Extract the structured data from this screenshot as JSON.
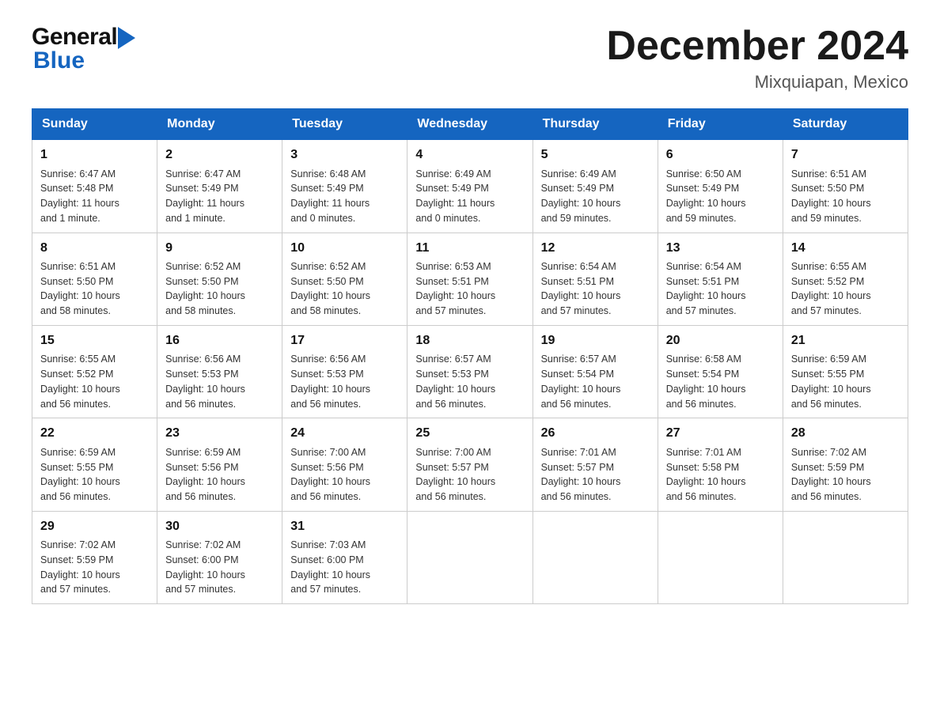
{
  "header": {
    "logo_general": "General",
    "logo_blue": "Blue",
    "month_title": "December 2024",
    "location": "Mixquiapan, Mexico"
  },
  "days_of_week": [
    "Sunday",
    "Monday",
    "Tuesday",
    "Wednesday",
    "Thursday",
    "Friday",
    "Saturday"
  ],
  "weeks": [
    [
      {
        "day": "1",
        "sunrise": "6:47 AM",
        "sunset": "5:48 PM",
        "daylight": "11 hours and 1 minute."
      },
      {
        "day": "2",
        "sunrise": "6:47 AM",
        "sunset": "5:49 PM",
        "daylight": "11 hours and 1 minute."
      },
      {
        "day": "3",
        "sunrise": "6:48 AM",
        "sunset": "5:49 PM",
        "daylight": "11 hours and 0 minutes."
      },
      {
        "day": "4",
        "sunrise": "6:49 AM",
        "sunset": "5:49 PM",
        "daylight": "11 hours and 0 minutes."
      },
      {
        "day": "5",
        "sunrise": "6:49 AM",
        "sunset": "5:49 PM",
        "daylight": "10 hours and 59 minutes."
      },
      {
        "day": "6",
        "sunrise": "6:50 AM",
        "sunset": "5:49 PM",
        "daylight": "10 hours and 59 minutes."
      },
      {
        "day": "7",
        "sunrise": "6:51 AM",
        "sunset": "5:50 PM",
        "daylight": "10 hours and 59 minutes."
      }
    ],
    [
      {
        "day": "8",
        "sunrise": "6:51 AM",
        "sunset": "5:50 PM",
        "daylight": "10 hours and 58 minutes."
      },
      {
        "day": "9",
        "sunrise": "6:52 AM",
        "sunset": "5:50 PM",
        "daylight": "10 hours and 58 minutes."
      },
      {
        "day": "10",
        "sunrise": "6:52 AM",
        "sunset": "5:50 PM",
        "daylight": "10 hours and 58 minutes."
      },
      {
        "day": "11",
        "sunrise": "6:53 AM",
        "sunset": "5:51 PM",
        "daylight": "10 hours and 57 minutes."
      },
      {
        "day": "12",
        "sunrise": "6:54 AM",
        "sunset": "5:51 PM",
        "daylight": "10 hours and 57 minutes."
      },
      {
        "day": "13",
        "sunrise": "6:54 AM",
        "sunset": "5:51 PM",
        "daylight": "10 hours and 57 minutes."
      },
      {
        "day": "14",
        "sunrise": "6:55 AM",
        "sunset": "5:52 PM",
        "daylight": "10 hours and 57 minutes."
      }
    ],
    [
      {
        "day": "15",
        "sunrise": "6:55 AM",
        "sunset": "5:52 PM",
        "daylight": "10 hours and 56 minutes."
      },
      {
        "day": "16",
        "sunrise": "6:56 AM",
        "sunset": "5:53 PM",
        "daylight": "10 hours and 56 minutes."
      },
      {
        "day": "17",
        "sunrise": "6:56 AM",
        "sunset": "5:53 PM",
        "daylight": "10 hours and 56 minutes."
      },
      {
        "day": "18",
        "sunrise": "6:57 AM",
        "sunset": "5:53 PM",
        "daylight": "10 hours and 56 minutes."
      },
      {
        "day": "19",
        "sunrise": "6:57 AM",
        "sunset": "5:54 PM",
        "daylight": "10 hours and 56 minutes."
      },
      {
        "day": "20",
        "sunrise": "6:58 AM",
        "sunset": "5:54 PM",
        "daylight": "10 hours and 56 minutes."
      },
      {
        "day": "21",
        "sunrise": "6:59 AM",
        "sunset": "5:55 PM",
        "daylight": "10 hours and 56 minutes."
      }
    ],
    [
      {
        "day": "22",
        "sunrise": "6:59 AM",
        "sunset": "5:55 PM",
        "daylight": "10 hours and 56 minutes."
      },
      {
        "day": "23",
        "sunrise": "6:59 AM",
        "sunset": "5:56 PM",
        "daylight": "10 hours and 56 minutes."
      },
      {
        "day": "24",
        "sunrise": "7:00 AM",
        "sunset": "5:56 PM",
        "daylight": "10 hours and 56 minutes."
      },
      {
        "day": "25",
        "sunrise": "7:00 AM",
        "sunset": "5:57 PM",
        "daylight": "10 hours and 56 minutes."
      },
      {
        "day": "26",
        "sunrise": "7:01 AM",
        "sunset": "5:57 PM",
        "daylight": "10 hours and 56 minutes."
      },
      {
        "day": "27",
        "sunrise": "7:01 AM",
        "sunset": "5:58 PM",
        "daylight": "10 hours and 56 minutes."
      },
      {
        "day": "28",
        "sunrise": "7:02 AM",
        "sunset": "5:59 PM",
        "daylight": "10 hours and 56 minutes."
      }
    ],
    [
      {
        "day": "29",
        "sunrise": "7:02 AM",
        "sunset": "5:59 PM",
        "daylight": "10 hours and 57 minutes."
      },
      {
        "day": "30",
        "sunrise": "7:02 AM",
        "sunset": "6:00 PM",
        "daylight": "10 hours and 57 minutes."
      },
      {
        "day": "31",
        "sunrise": "7:03 AM",
        "sunset": "6:00 PM",
        "daylight": "10 hours and 57 minutes."
      },
      null,
      null,
      null,
      null
    ]
  ],
  "labels": {
    "sunrise": "Sunrise:",
    "sunset": "Sunset:",
    "daylight": "Daylight:"
  }
}
